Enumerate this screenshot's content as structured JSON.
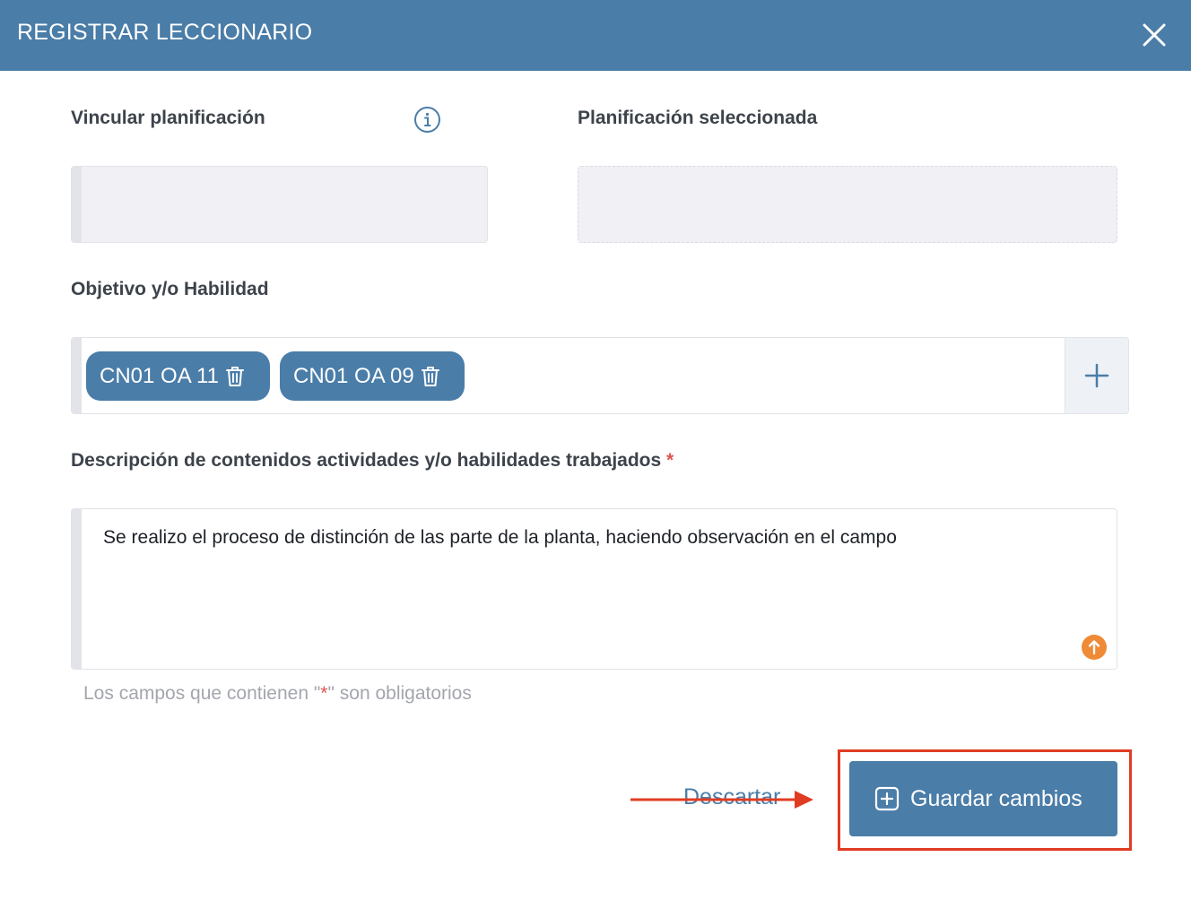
{
  "dialog": {
    "title": "REGISTRAR LECCIONARIO",
    "close_icon": "close-icon"
  },
  "form": {
    "link_planning": {
      "label": "Vincular planificación",
      "value": ""
    },
    "selected_planning": {
      "label": "Planificación seleccionada",
      "value": ""
    },
    "objectives": {
      "label": "Objetivo y/o Habilidad",
      "chips": [
        {
          "label": "CN01 OA 11"
        },
        {
          "label": "CN01 OA 09"
        }
      ]
    },
    "description": {
      "label": "Descripción de contenidos actividades y/o habilidades trabajados",
      "required_mark": "*",
      "value": "Se realizo el proceso de distinción de las parte de la planta, haciendo observación en el campo"
    },
    "required_hint": {
      "before": "Los campos que contienen \"",
      "mark": "*",
      "after": "\" son obligatorios"
    }
  },
  "footer": {
    "discard_label": "Descartar",
    "save_label": "Guardar cambios"
  },
  "colors": {
    "primary": "#4a7da8",
    "required": "#e05252",
    "annotation": "#e03c22",
    "upload": "#ef8a36"
  }
}
